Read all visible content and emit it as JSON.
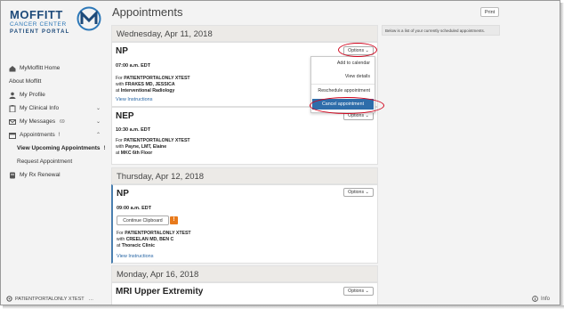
{
  "logo": {
    "name": "MOFFITT",
    "sub": "CANCER CENTER",
    "portal": "PATIENT PORTAL"
  },
  "sidebar": {
    "items": [
      {
        "label": "MyMoffitt Home",
        "icon": "home-icon"
      },
      {
        "label": "About Moffitt"
      },
      {
        "label": "My Profile",
        "icon": "user-icon"
      },
      {
        "label": "My Clinical Info",
        "icon": "clipboard-icon"
      },
      {
        "label": "My Messages",
        "icon": "envelope-icon",
        "badge": "69"
      },
      {
        "label": "Appointments",
        "icon": "calendar-icon",
        "alert": "!"
      },
      {
        "label": "View Upcoming Appointments",
        "alert": "!"
      },
      {
        "label": "Request Appointment"
      },
      {
        "label": "My Rx Renewal",
        "icon": "rx-icon"
      }
    ],
    "user": "PATIENTPORTALONLY XTEST"
  },
  "main": {
    "title": "Appointments",
    "print_label": "Print",
    "info_text": "Below is a list of your currently scheduled appointments.",
    "info_footer": "Info"
  },
  "dates": [
    "Wednesday, Apr 11, 2018",
    "Thursday, Apr 12, 2018",
    "Monday, Apr 16, 2018"
  ],
  "appointments": [
    {
      "title": "NP",
      "options": "Options",
      "time": "07:00 a.m. EDT",
      "for_label": "For",
      "patient": "PATIENTPORTALONLY XTEST",
      "with_label": "with",
      "provider": "FRAKES MD, JESSICA",
      "at_label": "at",
      "location": "Interventional Radiology",
      "link": "View Instructions"
    },
    {
      "title": "NEP",
      "options": "Options",
      "time": "10:30 a.m. EDT",
      "for_label": "For",
      "patient": "PATIENTPORTALONLY XTEST",
      "with_label": "with",
      "provider": "Payne, LMT, Elaine",
      "at_label": "at",
      "location": "MKC 6th Floor"
    },
    {
      "title": "NP",
      "options": "Options",
      "time": "09:00 a.m. EDT",
      "clipboard": "Continue Clipboard",
      "clipboard_alert": "!",
      "for_label": "For",
      "patient": "PATIENTPORTALONLY XTEST",
      "with_label": "with",
      "provider": "CREELAN MD, BEN C",
      "at_label": "at",
      "location": "Thoracic Clinic",
      "link": "View Instructions"
    },
    {
      "title": "MRI Upper Extremity",
      "options": "Options"
    }
  ],
  "options_menu": [
    "Add to calendar",
    "View details",
    "Reschedule appointment",
    "Cancel appointment"
  ],
  "colors": {
    "brand": "#1d4a7a",
    "accent": "#2e6daa",
    "alert": "#e87a1c",
    "highlight_ring": "#d0021b",
    "link": "#2463a3"
  }
}
